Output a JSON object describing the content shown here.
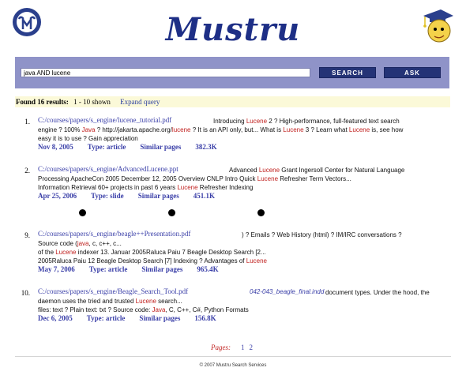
{
  "header": {
    "brand": "Mustru"
  },
  "search": {
    "query": "java AND lucene",
    "search_label": "SEARCH",
    "ask_label": "ASK"
  },
  "status": {
    "found": "Found 16 results:",
    "shown": "1 - 10 shown",
    "expand": "Expand query"
  },
  "results": [
    {
      "num": "1.",
      "url": "C:/courses/papers/s_engine/lucene_tutorial.pdf",
      "lines": [
        [
          [
            "Introducing ",
            ""
          ],
          [
            "Lucene",
            "hl"
          ],
          [
            " 2 ? High-performance, full-featured text search",
            ""
          ]
        ],
        [
          [
            "engine ? 100% ",
            ""
          ],
          [
            "Java",
            "hl"
          ],
          [
            " ? http://jakarta.apache.org/",
            ""
          ],
          [
            "lucene",
            "hl"
          ],
          [
            " ? It is an API only, but... What is ",
            ""
          ],
          [
            "Lucene",
            "hl"
          ],
          [
            " 3 ? Learn what ",
            ""
          ],
          [
            "Lucene",
            "hl"
          ],
          [
            " is, see how",
            ""
          ]
        ],
        [
          [
            "easy it is to use ? Gain appreciation",
            ""
          ]
        ]
      ],
      "date": "Nov 8, 2005",
      "type": "Type: article",
      "similar": "Similar pages",
      "size": "382.3K"
    },
    {
      "num": "2.",
      "url": "C:/courses/papers/s_engine/AdvancedLucene.ppt",
      "lines": [
        [
          [
            "Advanced ",
            ""
          ],
          [
            "Lucene",
            "hl"
          ],
          [
            " Grant Ingersoll Center for Natural Language",
            ""
          ]
        ],
        [
          [
            "Processing ApacheCon 2005 December 12, 2005 Overview CNLP Intro Quick ",
            ""
          ],
          [
            "Lucene",
            "hl"
          ],
          [
            " Refresher Term Vectors...",
            ""
          ]
        ],
        [
          [
            "Information Retrieval 60+ projects in past 6 years ",
            ""
          ],
          [
            "Lucene",
            "hl"
          ],
          [
            " Refresher Indexing",
            ""
          ]
        ]
      ],
      "date": "Apr 25, 2006",
      "type": "Type: slide",
      "similar": "Similar pages",
      "size": "451.1K"
    },
    {
      "num": "9.",
      "url": "C:/courses/papers/s_engine/beagle++Presentation.pdf",
      "lines": [
        [
          [
            ") ? Emails ? Web History (html) ? IM/IRC conversations ?",
            ""
          ]
        ],
        [
          [
            "Source code (",
            ""
          ],
          [
            "java",
            "hl"
          ],
          [
            ", c, c++, c...",
            ""
          ]
        ],
        [
          [
            "of the ",
            ""
          ],
          [
            "Lucene",
            "hl"
          ],
          [
            " indexer 13. Januar 2005Raluca Paiu 7 Beagle Desktop Search [2...",
            ""
          ]
        ],
        [
          [
            "2005Raluca Paiu 12 Beagle Desktop Search [7]  Indexing ? Advantages of ",
            ""
          ],
          [
            "Lucene",
            "hl"
          ]
        ]
      ],
      "date": "May 7, 2006",
      "type": "Type: article",
      "similar": "Similar pages",
      "size": "965.4K"
    },
    {
      "num": "10.",
      "url": "C:/courses/papers/s_engine/Beagle_Search_Tool.pdf",
      "extra_link": "042-043_beagle_final.indd",
      "lines": [
        [
          [
            "document types. Under the hood, the",
            ""
          ]
        ],
        [
          [
            "daemon uses the tried and trusted ",
            ""
          ],
          [
            "Lucene",
            "hl"
          ],
          [
            " search...",
            ""
          ]
        ],
        [
          [
            "files: text ? Plain text: txt ? Source code: ",
            ""
          ],
          [
            "Java",
            "hl"
          ],
          [
            ", C, C++, C#, Python Formats",
            ""
          ]
        ]
      ],
      "date": "Dec 6, 2005",
      "type": "Type: article",
      "similar": "Similar pages",
      "size": "156.8K"
    }
  ],
  "pager": {
    "label": "Pages:",
    "pages": [
      "1",
      "2"
    ]
  },
  "footer": "© 2007 Mustru Search Services",
  "colors": {
    "brand": "#1e2f86",
    "search_band": "#8f93c8",
    "button": "#243376",
    "link": "#3a3fa8",
    "highlight": "#c0201e",
    "status_band": "#fbf9d8"
  }
}
